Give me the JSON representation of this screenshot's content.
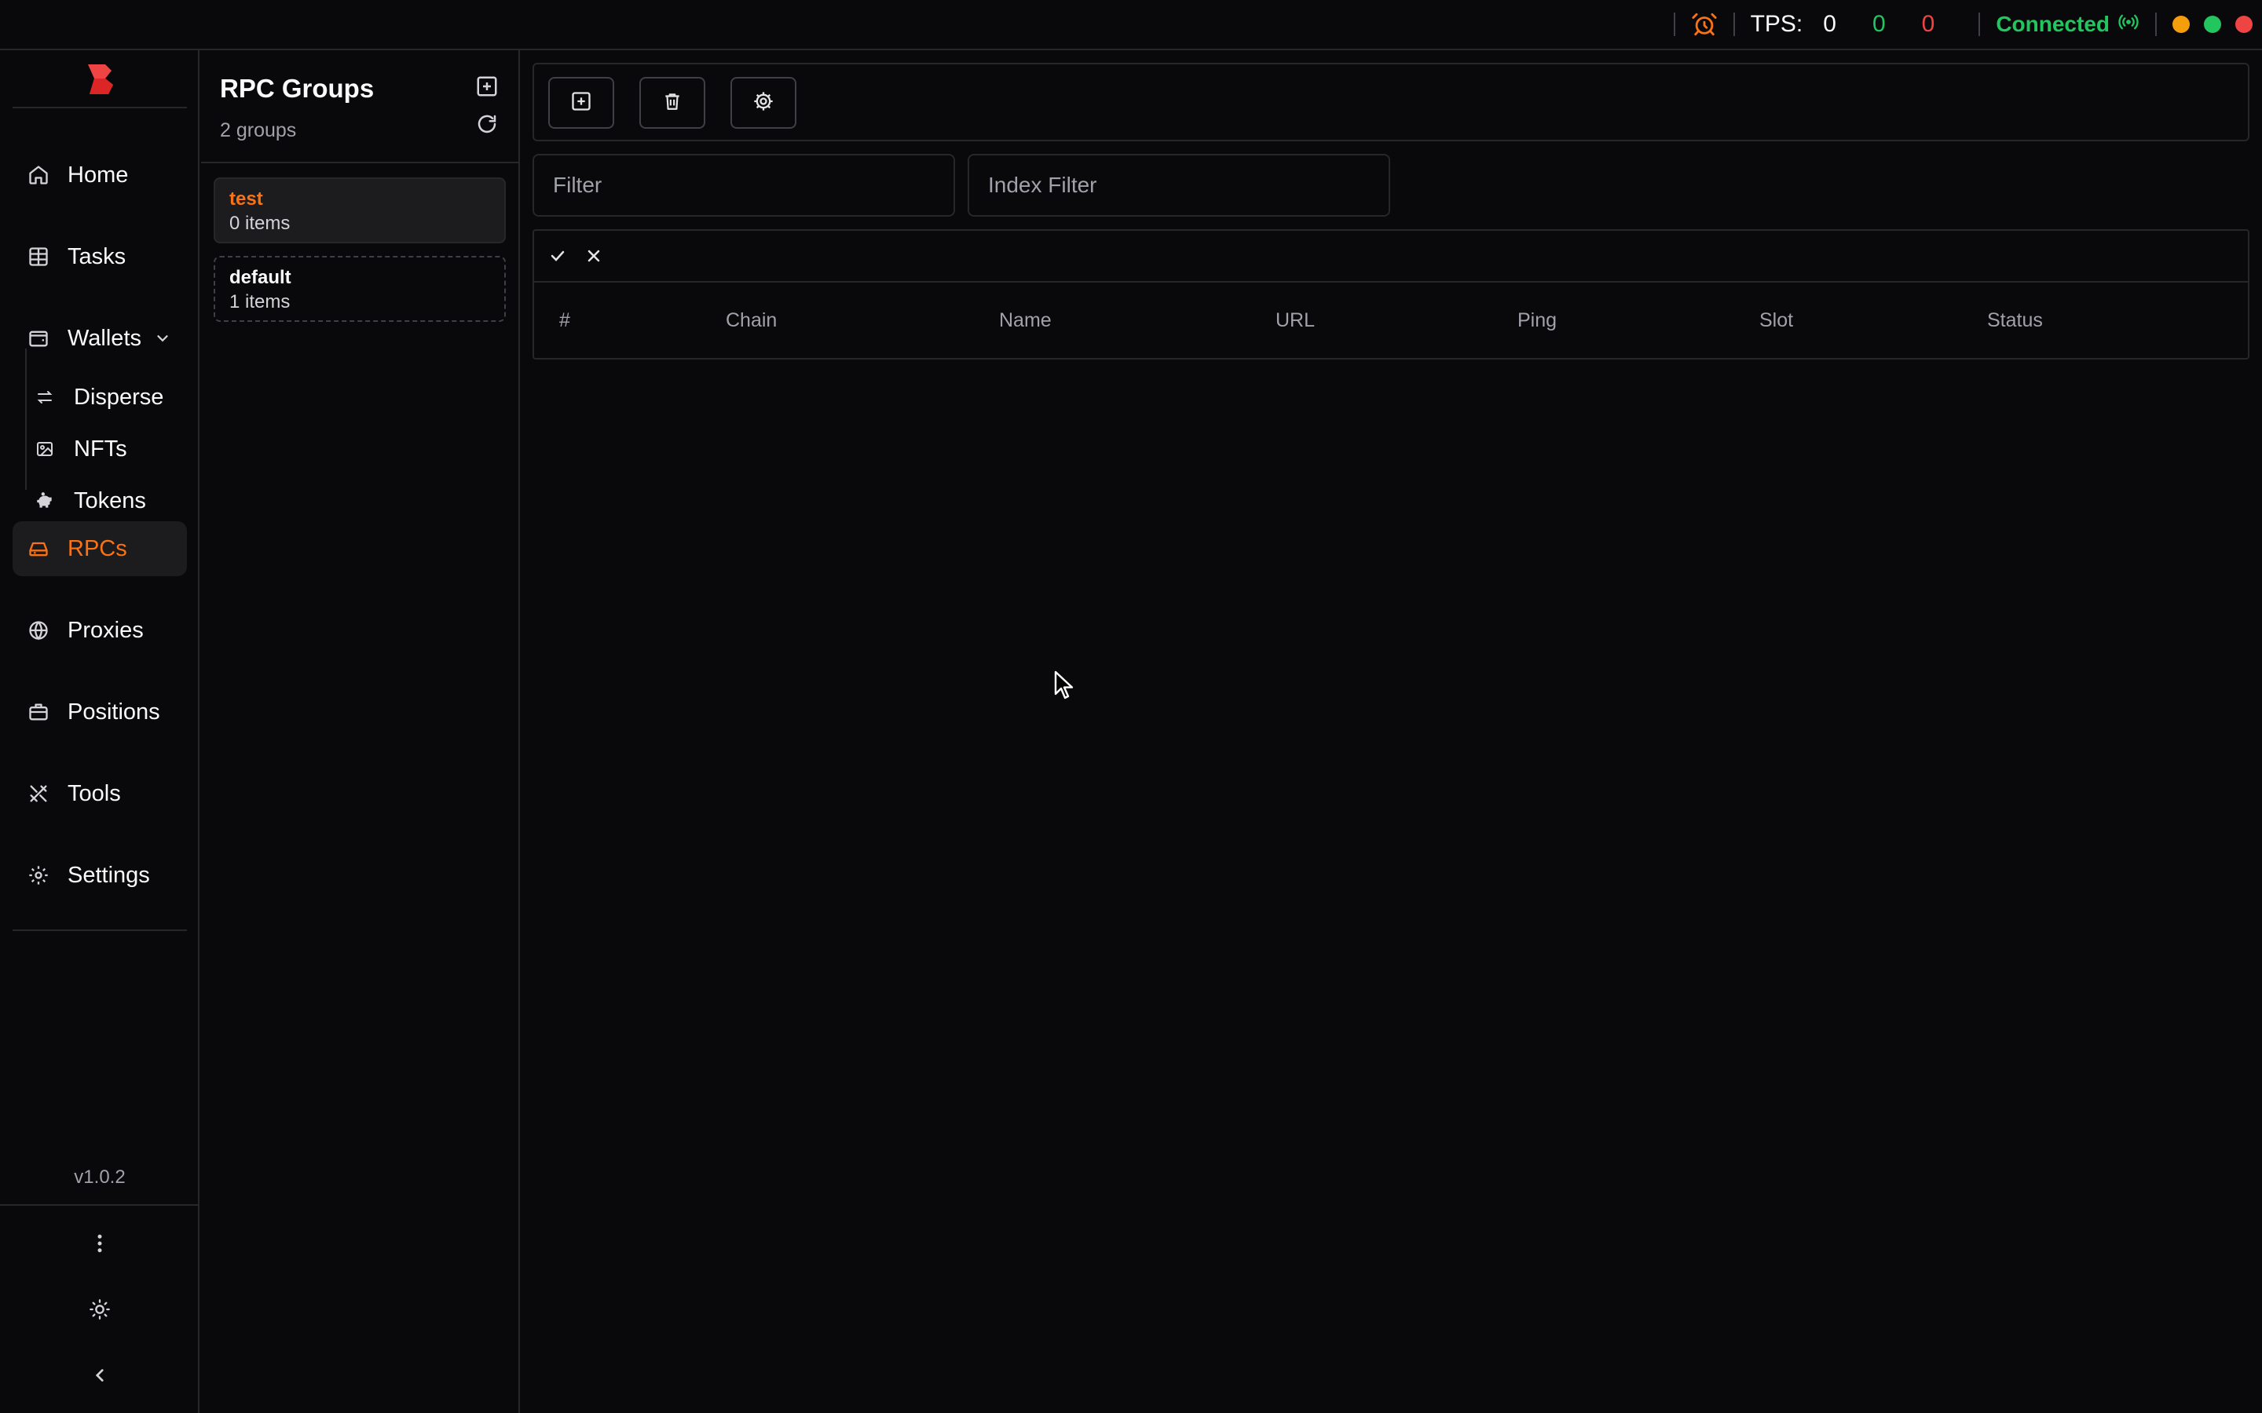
{
  "topbar": {
    "tps_label": "TPS:",
    "tps_values": [
      "0",
      "0",
      "0"
    ],
    "connection_status": "Connected",
    "colors": {
      "accent": "#f97316",
      "success": "#22c55e",
      "danger": "#ef4444",
      "warning": "#f59e0b"
    }
  },
  "nav": {
    "items": [
      {
        "label": "Home",
        "icon": "home-icon"
      },
      {
        "label": "Tasks",
        "icon": "table-icon"
      },
      {
        "label": "Wallets",
        "icon": "wallet-icon"
      },
      {
        "label": "RPCs",
        "icon": "server-icon",
        "active": true
      },
      {
        "label": "Proxies",
        "icon": "globe-icon"
      },
      {
        "label": "Positions",
        "icon": "briefcase-icon"
      },
      {
        "label": "Tools",
        "icon": "tools-icon"
      },
      {
        "label": "Settings",
        "icon": "gear-icon"
      }
    ],
    "wallet_sub": [
      {
        "label": "Disperse",
        "icon": "arrows-icon"
      },
      {
        "label": "NFTs",
        "icon": "image-icon"
      },
      {
        "label": "Tokens",
        "icon": "piggy-bank-icon"
      }
    ],
    "version": "v1.0.2"
  },
  "groups": {
    "title": "RPC Groups",
    "count": "2 groups",
    "list": [
      {
        "name": "test",
        "items": "0 items",
        "selected": true
      },
      {
        "name": "default",
        "items": "1 items",
        "selected": false
      }
    ]
  },
  "main": {
    "filter_placeholder": "Filter",
    "index_filter_placeholder": "Index Filter",
    "columns": [
      "#",
      "Chain",
      "Name",
      "URL",
      "Ping",
      "Slot",
      "Status"
    ]
  }
}
